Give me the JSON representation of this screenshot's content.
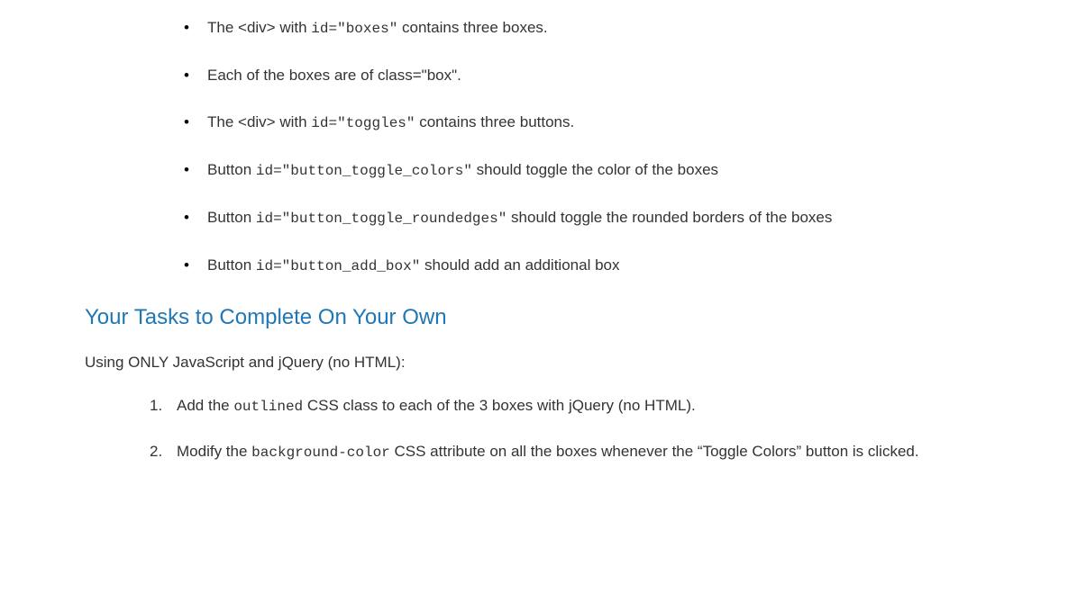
{
  "bullets": [
    {
      "pre": "The <div> with ",
      "code": "id=\"boxes\"",
      "post": " contains three boxes."
    },
    {
      "pre": "Each of the boxes are of class=\"box\".",
      "code": "",
      "post": ""
    },
    {
      "pre": "The <div> with ",
      "code": "id=\"toggles\"",
      "post": " contains three buttons."
    },
    {
      "pre": "Button ",
      "code": "id=\"button_toggle_colors\"",
      "post": " should toggle the color of the boxes"
    },
    {
      "pre": "Button ",
      "code": "id=\"button_toggle_roundedges\"",
      "post": " should toggle the rounded borders of the boxes"
    },
    {
      "pre": "Button ",
      "code": "id=\"button_add_box\"",
      "post": " should add an additional box"
    }
  ],
  "heading": "Your Tasks to Complete On Your Own",
  "lead": "Using ONLY JavaScript and jQuery (no HTML):",
  "tasks": [
    {
      "pre": "Add the ",
      "code": "outlined",
      "post": " CSS class to each of the 3 boxes with jQuery (no HTML)."
    },
    {
      "pre": "Modify the ",
      "code": "background-color",
      "post": " CSS attribute on all the boxes whenever the “Toggle Colors” button is clicked."
    }
  ]
}
